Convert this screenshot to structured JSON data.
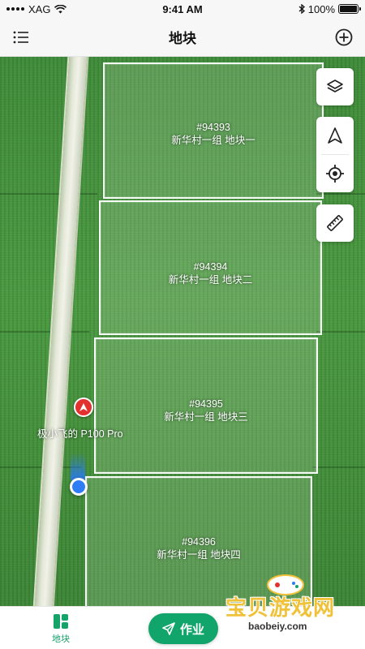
{
  "status_bar": {
    "carrier": "XAG",
    "time": "9:41 AM",
    "battery_text": "100%",
    "battery_level": 1.0
  },
  "nav": {
    "title": "地块",
    "menu_icon": "list-icon",
    "add_icon": "add-circle-icon"
  },
  "map": {
    "plots": [
      {
        "id": "#94393",
        "name": "新华村一组 地块一"
      },
      {
        "id": "#94394",
        "name": "新华村一组 地块二"
      },
      {
        "id": "#94395",
        "name": "新华村一组 地块三"
      },
      {
        "id": "#94396",
        "name": "新华村一组 地块四"
      }
    ],
    "drone_label": "极小飞的 P100 Pro",
    "controls": [
      "layers-icon",
      "navigate-arrow-icon",
      "locate-target-icon",
      "ruler-icon"
    ]
  },
  "tab_bar": {
    "plots_label": "地块",
    "work_label": "作业",
    "accent_color": "#12a56b"
  },
  "watermark": {
    "title": "宝贝游戏网",
    "url": "baobeiy.com"
  }
}
